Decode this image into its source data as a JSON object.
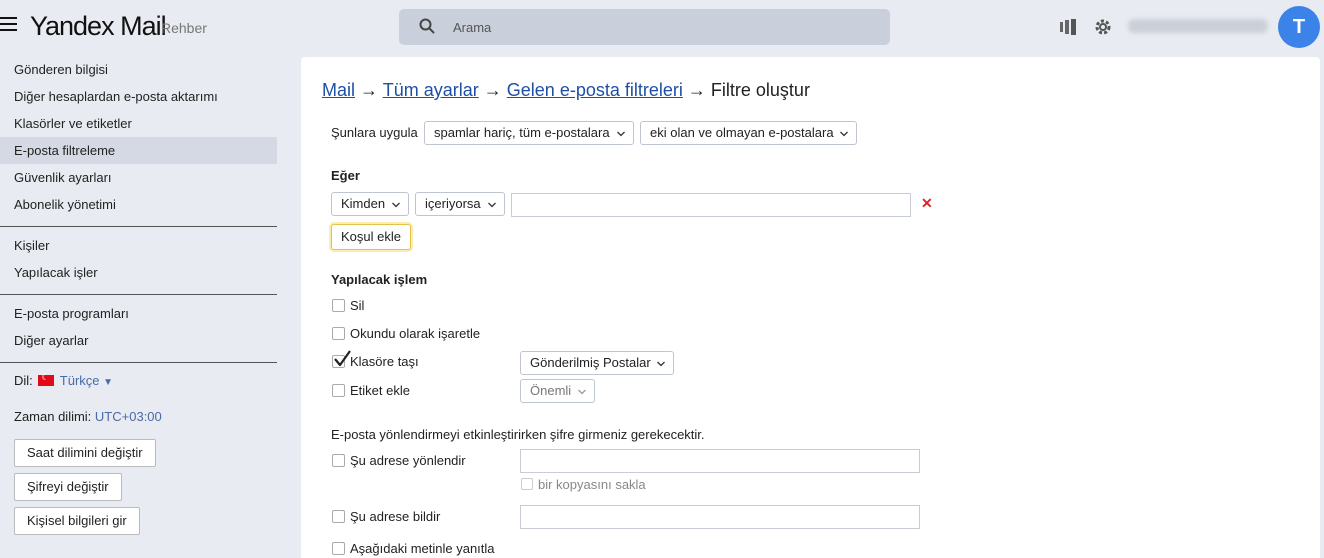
{
  "header": {
    "logo_brand": "Yandex",
    "logo_product": "Mail",
    "contacts_link": "Rehber",
    "search_placeholder": "Arama",
    "avatar_letter": "T"
  },
  "sidebar": {
    "items": [
      {
        "label": "Gönderen bilgisi"
      },
      {
        "label": "Diğer hesaplardan e-posta aktarımı"
      },
      {
        "label": "Klasörler ve etiketler"
      },
      {
        "label": "E-posta filtreleme",
        "active": true
      },
      {
        "label": "Güvenlik ayarları"
      },
      {
        "label": "Abonelik yönetimi"
      },
      {
        "label": "Kişiler"
      },
      {
        "label": "Yapılacak işler"
      },
      {
        "label": "E-posta programları"
      },
      {
        "label": "Diğer ayarlar"
      }
    ],
    "language_label": "Dil:",
    "language_value": "Türkçe",
    "timezone_label": "Zaman dilimi:",
    "timezone_value": "UTC+03:00",
    "buttons": {
      "change_timezone": "Saat dilimini değiştir",
      "change_password": "Şifreyi değiştir",
      "personal_info": "Kişisel bilgileri gir"
    }
  },
  "main": {
    "breadcrumb": {
      "mail": "Mail",
      "all_settings": "Tüm ayarlar",
      "incoming_filters": "Gelen e-posta filtreleri",
      "current": "Filtre oluştur",
      "separator": "→"
    },
    "apply_label": "Şunlara uygula",
    "apply_scope": "spamlar hariç, tüm e-postalara",
    "apply_attachments": "eki olan ve olmayan e-postalara",
    "if_heading": "Eğer",
    "condition_field": "Kimden",
    "condition_operator": "içeriyorsa",
    "condition_value": "",
    "add_condition": "Koşul ekle",
    "action_heading": "Yapılacak işlem",
    "actions": {
      "delete": {
        "label": "Sil",
        "checked": false
      },
      "mark_read": {
        "label": "Okundu olarak işaretle",
        "checked": false
      },
      "move_folder": {
        "label": "Klasöre taşı",
        "checked": true,
        "folder": "Gönderilmiş Postalar"
      },
      "add_label": {
        "label": "Etiket ekle",
        "checked": false,
        "label_value": "Önemli"
      }
    },
    "password_notice": "E-posta yönlendirmeyi etkinleştirirken şifre girmeniz gerekecektir.",
    "forward": {
      "label": "Şu adrese yönlendir",
      "checked": false,
      "keep_copy": "bir kopyasını sakla"
    },
    "notify": {
      "label": "Şu adrese bildir",
      "checked": false
    },
    "reply": {
      "label": "Aşağıdaki metinle yanıtla",
      "checked": false
    }
  }
}
